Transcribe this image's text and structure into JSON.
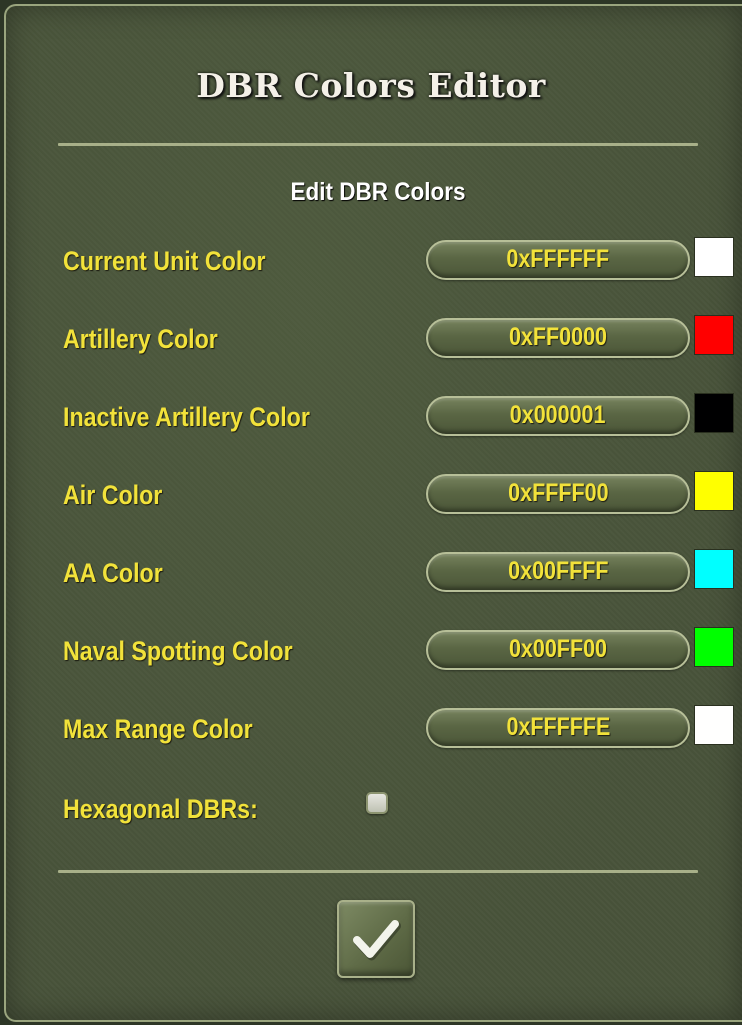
{
  "dialog": {
    "title": "DBR Colors Editor",
    "subtitle": "Edit DBR Colors"
  },
  "colors": [
    {
      "label": "Current Unit Color",
      "value": "0xFFFFFF",
      "swatch": "#FFFFFF"
    },
    {
      "label": "Artillery Color",
      "value": "0xFF0000",
      "swatch": "#FF0000"
    },
    {
      "label": "Inactive Artillery Color",
      "value": "0x000001",
      "swatch": "#000001"
    },
    {
      "label": "Air Color",
      "value": "0xFFFF00",
      "swatch": "#FFFF00"
    },
    {
      "label": "AA Color",
      "value": "0x00FFFF",
      "swatch": "#00FFFF"
    },
    {
      "label": "Naval Spotting Color",
      "value": "0x00FF00",
      "swatch": "#00FF00"
    },
    {
      "label": "Max Range Color",
      "value": "0xFFFFFE",
      "swatch": "#FFFFFE"
    }
  ],
  "hexagonal": {
    "label": "Hexagonal DBRs:",
    "checked": false
  },
  "ok_button": {
    "icon": "checkmark-icon"
  },
  "theme": {
    "label_color": "#F2E23A",
    "panel_color": "#48533A"
  }
}
